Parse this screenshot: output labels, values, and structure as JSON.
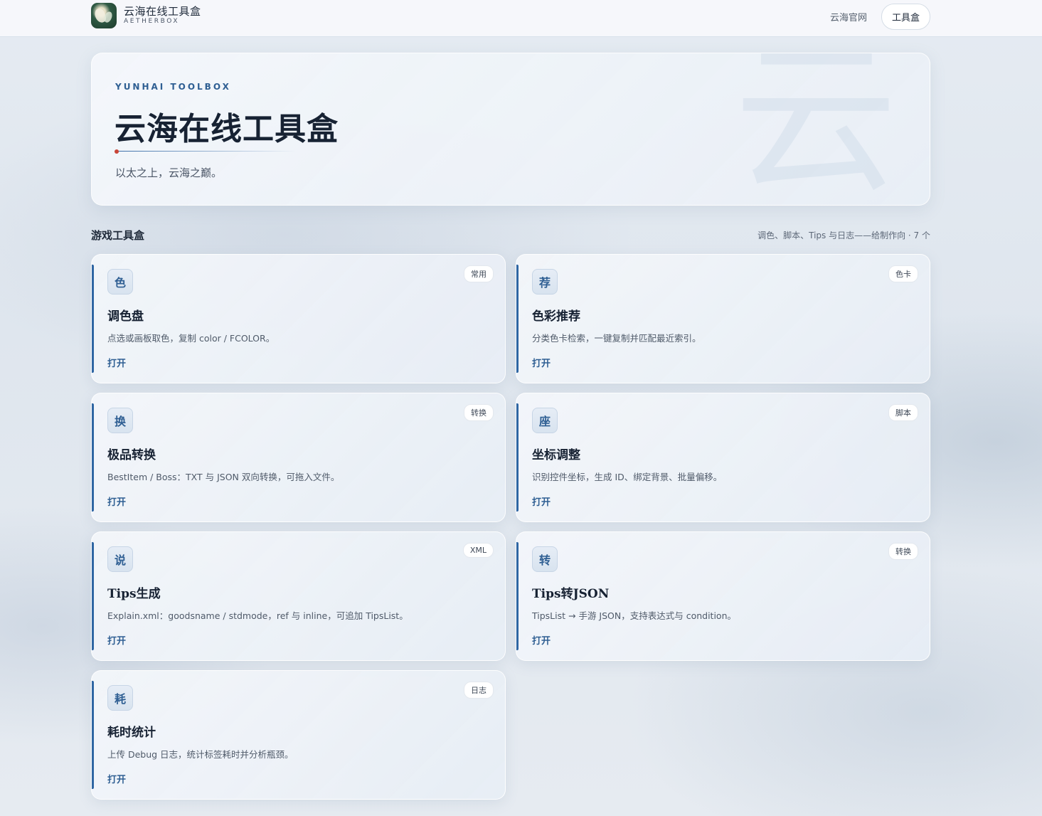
{
  "header": {
    "brand_name": "云海在线工具盒",
    "brand_sub": "AETHERBOX",
    "nav_link": "云海官网",
    "nav_active": "工具盒"
  },
  "hero": {
    "kicker": "YUNHAI TOOLBOX",
    "title": "云海在线工具盒",
    "subtitle": "以太之上，云海之巅。",
    "watermark": "云"
  },
  "section": {
    "title": "游戏工具盒",
    "meta": "调色、脚本、Tips 与日志——给制作向 · 7 个"
  },
  "cards": [
    {
      "icon": "色",
      "tag": "常用",
      "title": "调色盘",
      "desc": "点选或画板取色，复制 color / FCOLOR。",
      "action": "打开"
    },
    {
      "icon": "荐",
      "tag": "色卡",
      "title": "色彩推荐",
      "desc": "分类色卡检索，一键复制并匹配最近索引。",
      "action": "打开"
    },
    {
      "icon": "换",
      "tag": "转换",
      "title": "极品转换",
      "desc": "BestItem / Boss：TXT 与 JSON 双向转换，可拖入文件。",
      "action": "打开"
    },
    {
      "icon": "座",
      "tag": "脚本",
      "title": "坐标调整",
      "desc": "识别控件坐标，生成 ID、绑定背景、批量偏移。",
      "action": "打开"
    },
    {
      "icon": "说",
      "tag": "XML",
      "title": "Tips生成",
      "desc": "Explain.xml：goodsname / stdmode，ref 与 inline，可追加 TipsList。",
      "action": "打开"
    },
    {
      "icon": "转",
      "tag": "转换",
      "title": "Tips转JSON",
      "desc": "TipsList → 手游 JSON，支持表达式与 condition。",
      "action": "打开"
    },
    {
      "icon": "耗",
      "tag": "日志",
      "title": "耗时统计",
      "desc": "上传 Debug 日志，统计标签耗时并分析瓶颈。",
      "action": "打开"
    }
  ]
}
